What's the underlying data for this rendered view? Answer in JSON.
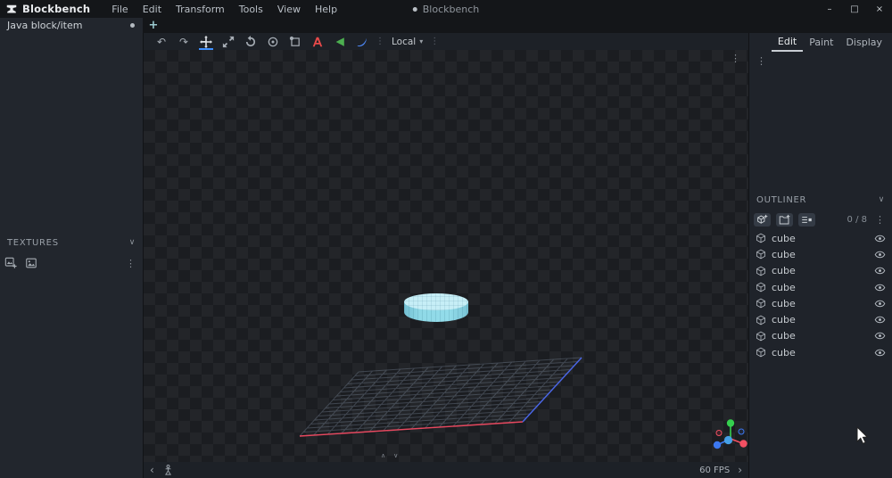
{
  "titlebar": {
    "app_name": "Blockbench",
    "menus": [
      "File",
      "Edit",
      "Transform",
      "Tools",
      "View",
      "Help"
    ],
    "window_title": "Blockbench",
    "minimize": "–",
    "maximize": "□",
    "close": "×"
  },
  "project_tab": {
    "label": "Java block/item",
    "new_tab": "+"
  },
  "left_panel": {
    "textures_header": "TEXTURES"
  },
  "viewport_toolbar": {
    "transform_space": "Local"
  },
  "mode_tabs": {
    "edit": "Edit",
    "paint": "Paint",
    "display": "Display"
  },
  "outliner": {
    "header": "OUTLINER",
    "counter": "0 / 8",
    "items": [
      {
        "label": "cube"
      },
      {
        "label": "cube"
      },
      {
        "label": "cube"
      },
      {
        "label": "cube"
      },
      {
        "label": "cube"
      },
      {
        "label": "cube"
      },
      {
        "label": "cube"
      },
      {
        "label": "cube"
      }
    ]
  },
  "statusbar": {
    "fps": "60 FPS"
  },
  "icons": {
    "kebab": "⋮",
    "chevron_down": "∨",
    "collapse_up": "∧",
    "collapse_down": "∨",
    "chevron_left": "‹",
    "chevron_right": "›",
    "caret_down": "▾",
    "undo": "↶",
    "redo": "↷"
  },
  "colors": {
    "accent": "#3e90ff",
    "axis_x": "#e8485f",
    "axis_y": "#35d04e",
    "axis_z": "#4a66e8",
    "cylinder_top": "#c6eef6",
    "cylinder_side": "#8fd9e7"
  }
}
